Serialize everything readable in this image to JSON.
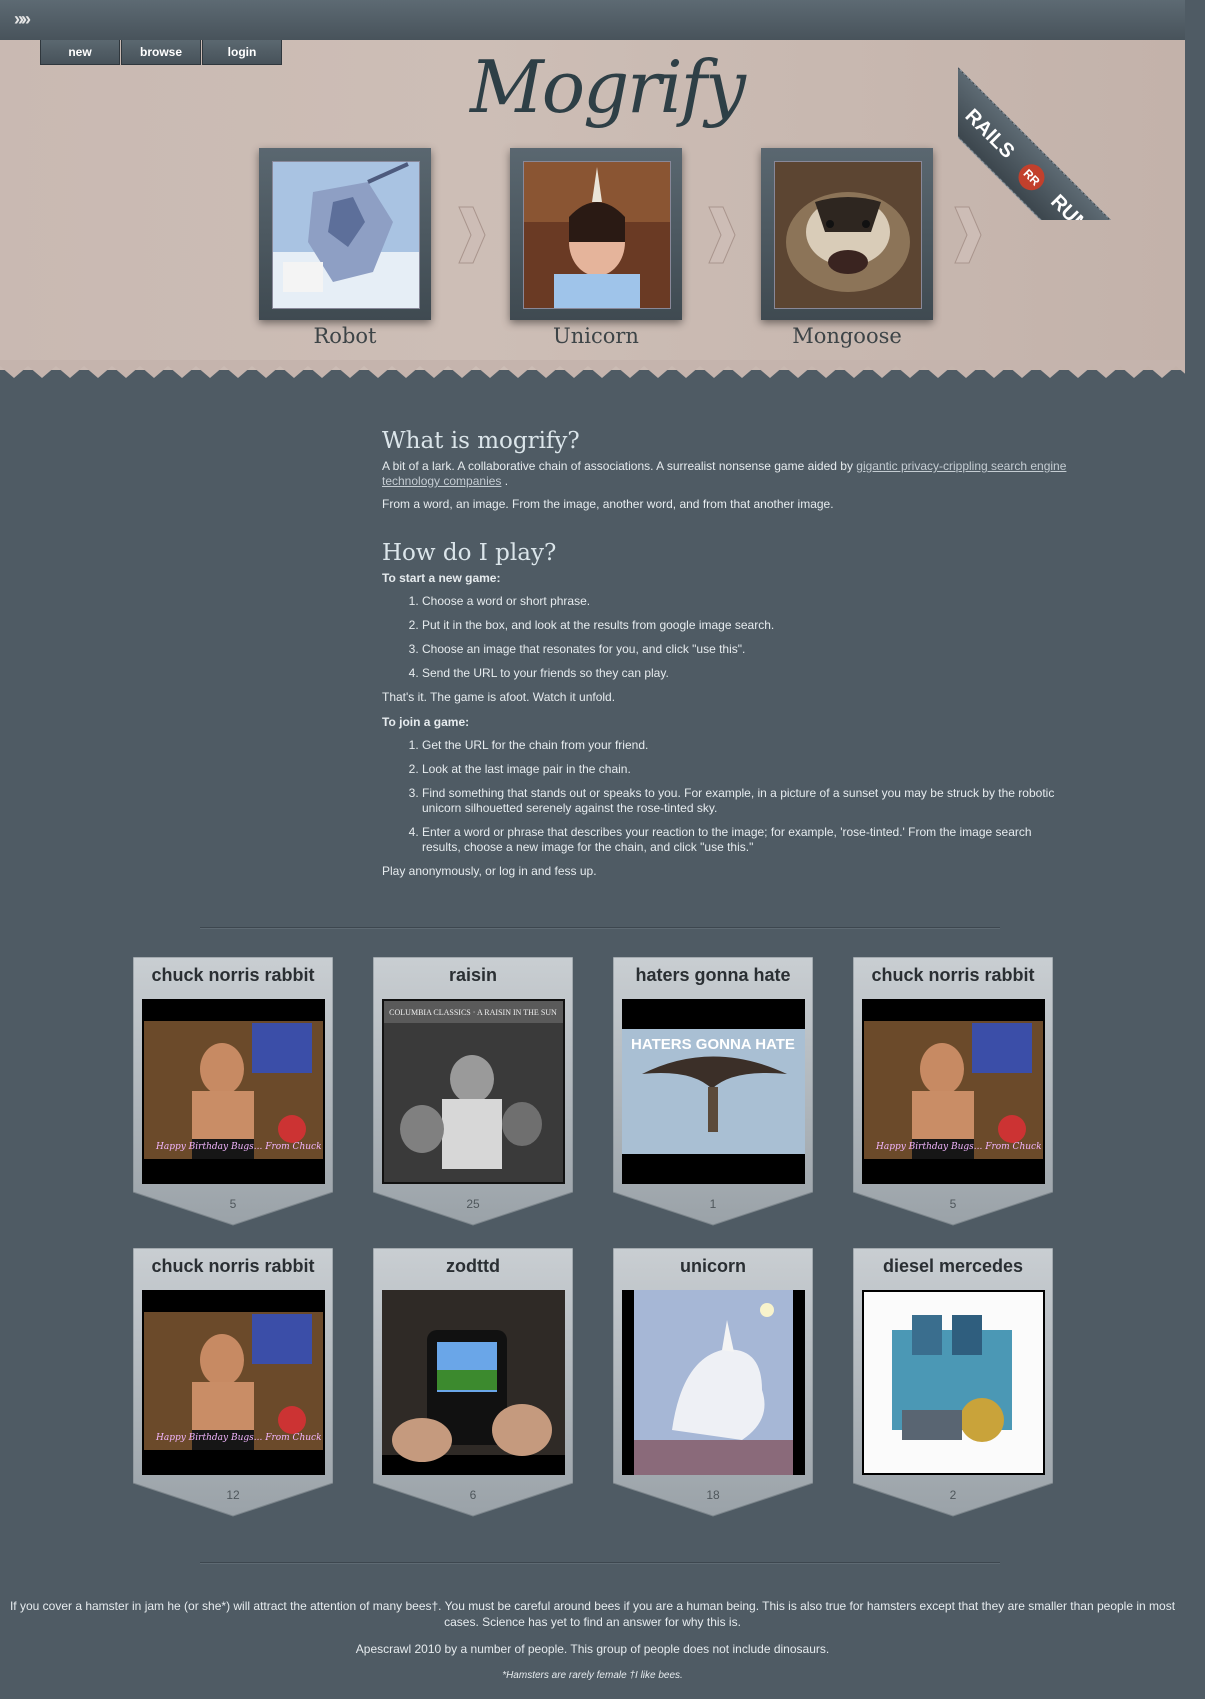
{
  "topbar": {
    "icon": "triple-chevron-icon",
    "icon_glyph": "»»"
  },
  "nav": [
    {
      "label": "new"
    },
    {
      "label": "browse"
    },
    {
      "label": "login"
    }
  ],
  "header": {
    "logo": "Mogrify",
    "ribbon_left": "RAILS",
    "ribbon_right": "RUMBLE",
    "ribbon_logo": "RR",
    "chain": [
      {
        "label": "Robot"
      },
      {
        "label": "Unicorn"
      },
      {
        "label": "Mongoose"
      }
    ]
  },
  "about": {
    "heading": "What is mogrify?",
    "intro_text": "A bit of a lark. A collaborative chain of associations. A surrealist nonsense game aided by ",
    "intro_link": "gigantic privacy-crippling search engine technology companies",
    "intro_end": " .",
    "line2": "From a word, an image. From the image, another word, and from that another image."
  },
  "howto": {
    "heading": "How do I play?",
    "start_title": "To start a new game:",
    "start_steps": [
      "Choose a word or short phrase.",
      "Put it in the box, and look at the results from google image search.",
      "Choose an image that resonates for you, and click \"use this\".",
      "Send the URL to your friends so they can play."
    ],
    "start_end": "That's it. The game is afoot. Watch it unfold.",
    "join_title": "To join a game:",
    "join_steps": [
      "Get the URL for the chain from your friend.",
      "Look at the last image pair in the chain.",
      "Find something that stands out or speaks to you. For example, in a picture of a sunset you may be struck by the robotic unicorn silhouetted serenely against the rose-tinted sky.",
      "Enter a word or phrase that describes your reaction to the image; for example, 'rose-tinted.' From the image search results, choose a new image for the chain, and click \"use this.\""
    ],
    "join_end": "Play anonymously, or log in and fess up."
  },
  "cards": [
    {
      "title": "chuck norris rabbit",
      "count": "5",
      "image_text": "Happy Birthday Bugs... From Chuck"
    },
    {
      "title": "raisin",
      "count": "25",
      "image_text": "COLUMBIA CLASSICS · A RAISIN IN THE SUN"
    },
    {
      "title": "haters gonna hate",
      "count": "1",
      "image_text": "HATERS GONNA HATE"
    },
    {
      "title": "chuck norris rabbit",
      "count": "5",
      "image_text": "Happy Birthday Bugs... From Chuck"
    },
    {
      "title": "chuck norris rabbit",
      "count": "12",
      "image_text": "Happy Birthday Bugs... From Chuck"
    },
    {
      "title": "zodttd",
      "count": "6",
      "image_text": ""
    },
    {
      "title": "unicorn",
      "count": "18",
      "image_text": ""
    },
    {
      "title": "diesel mercedes",
      "count": "2",
      "image_text": ""
    }
  ],
  "footer": {
    "line1": "If you cover a hamster in jam he (or she*) will attract the attention of many bees†. You must be careful around bees if you are a human being. This is also true for hamsters except that they are smaller than people in most cases. Science has yet to find an answer for why this is.",
    "line2": "Apescrawl 2010 by a number of people. This group of people does not include dinosaurs.",
    "line3": "*Hamsters are rarely female †I like bees."
  }
}
